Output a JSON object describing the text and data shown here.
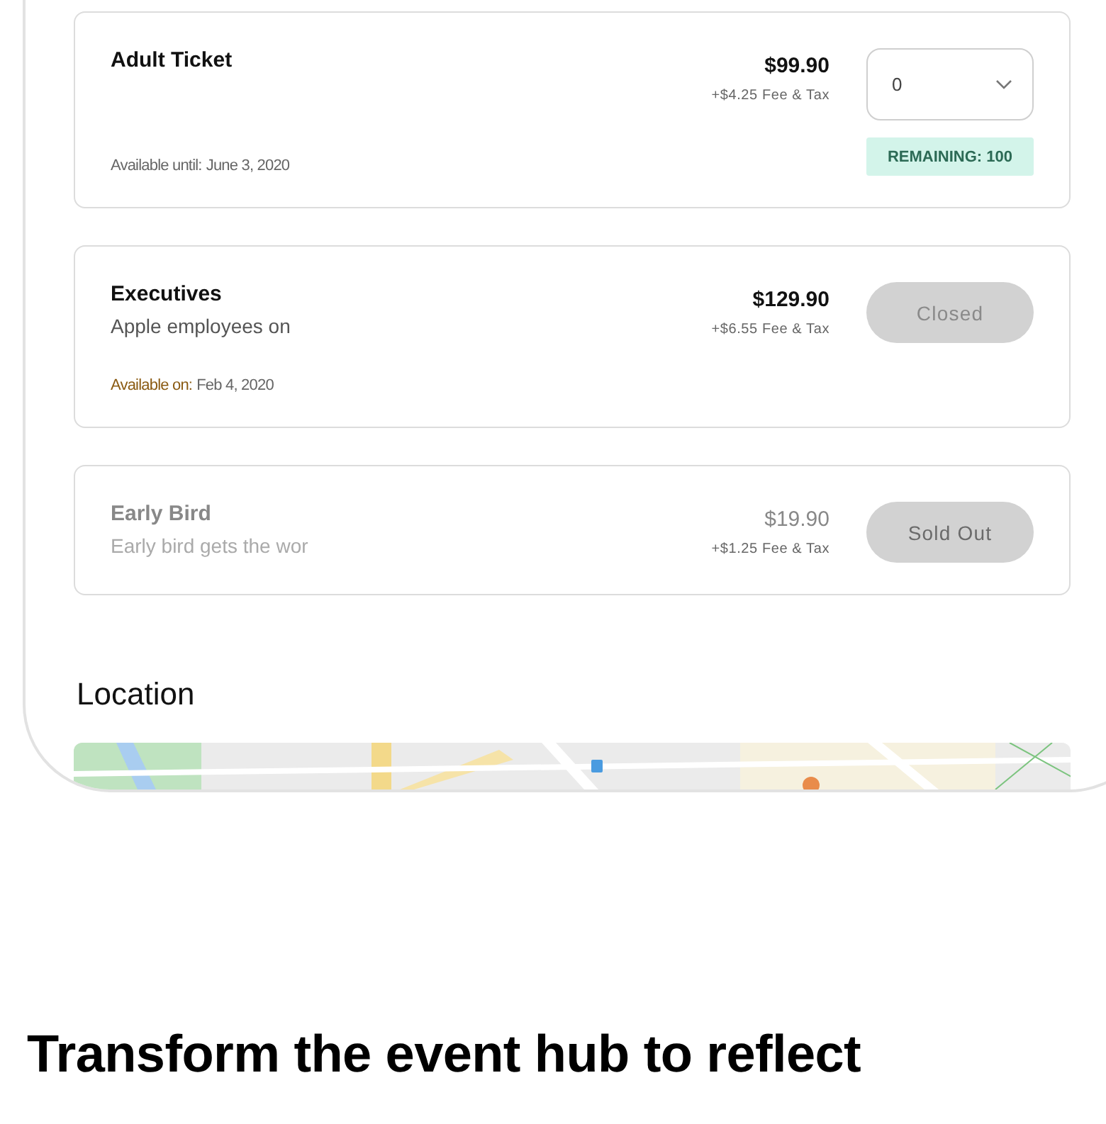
{
  "tickets": [
    {
      "name": "Adult Ticket",
      "price": "$99.90",
      "fee": "+$4.25 Fee & Tax",
      "dimmed": false,
      "availability": {
        "label": "Available until:",
        "value": "June 3, 2020",
        "highlight": false
      },
      "action": {
        "kind": "select",
        "value": "0"
      },
      "remaining": "REMAINING: 100"
    },
    {
      "name": "Executives",
      "description": "Apple employees on",
      "price": "$129.90",
      "fee": "+$6.55 Fee & Tax",
      "dimmed": false,
      "availability": {
        "label": "Available on:",
        "value": "Feb 4, 2020",
        "highlight": true
      },
      "action": {
        "kind": "status",
        "label": "Closed"
      }
    },
    {
      "name": "Early Bird",
      "description": "Early bird gets the wor",
      "price": "$19.90",
      "fee": "+$1.25 Fee & Tax",
      "dimmed": true,
      "action": {
        "kind": "status",
        "label": "Sold Out"
      }
    }
  ],
  "location": {
    "title": "Location"
  },
  "headline": "Transform the event hub to reflect"
}
